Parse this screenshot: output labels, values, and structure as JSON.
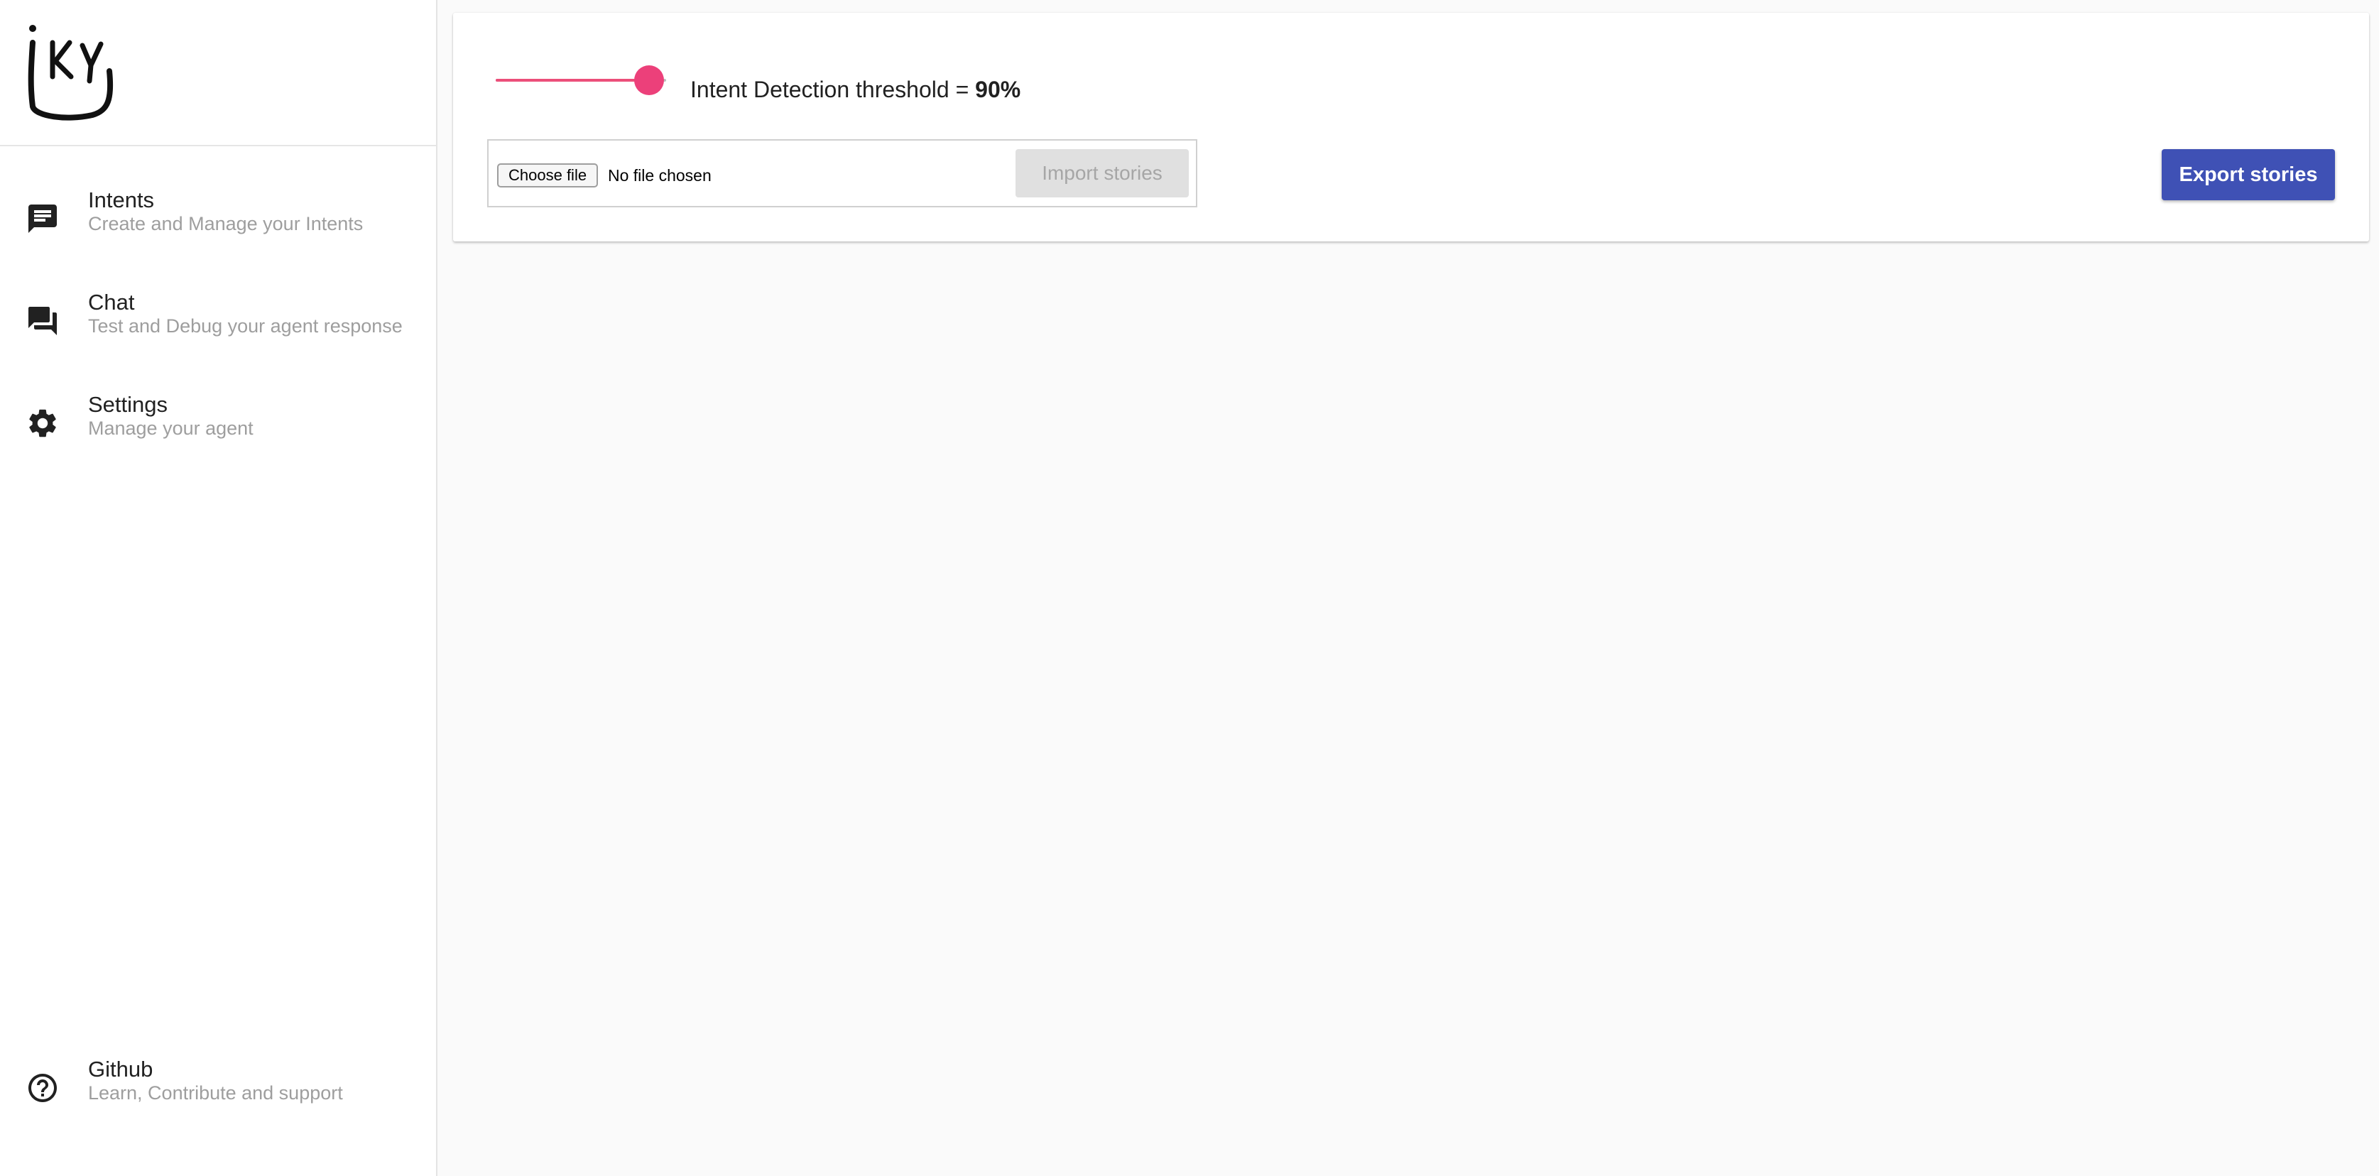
{
  "app": {
    "logo_text": "iky"
  },
  "sidebar": {
    "items": [
      {
        "id": "intents",
        "title": "Intents",
        "subtitle": "Create and Manage your Intents",
        "icon": "message-icon"
      },
      {
        "id": "chat",
        "title": "Chat",
        "subtitle": "Test and Debug your agent response",
        "icon": "forum-icon"
      },
      {
        "id": "settings",
        "title": "Settings",
        "subtitle": "Manage your agent",
        "icon": "gear-icon"
      }
    ],
    "footer": {
      "id": "github",
      "title": "Github",
      "subtitle": "Learn, Contribute and support",
      "icon": "help-circle-icon"
    }
  },
  "settings": {
    "threshold_label": "Intent Detection threshold = ",
    "threshold_value": "90%",
    "threshold_fraction": 0.9,
    "choose_file_label": "Choose file",
    "no_file_label": "No file chosen",
    "import_label": "Import stories",
    "export_label": "Export stories"
  },
  "colors": {
    "accent": "#ec407a",
    "primary": "#3f51b5",
    "disabled_bg": "#e0e0e0",
    "subtitle": "#9e9e9e"
  }
}
